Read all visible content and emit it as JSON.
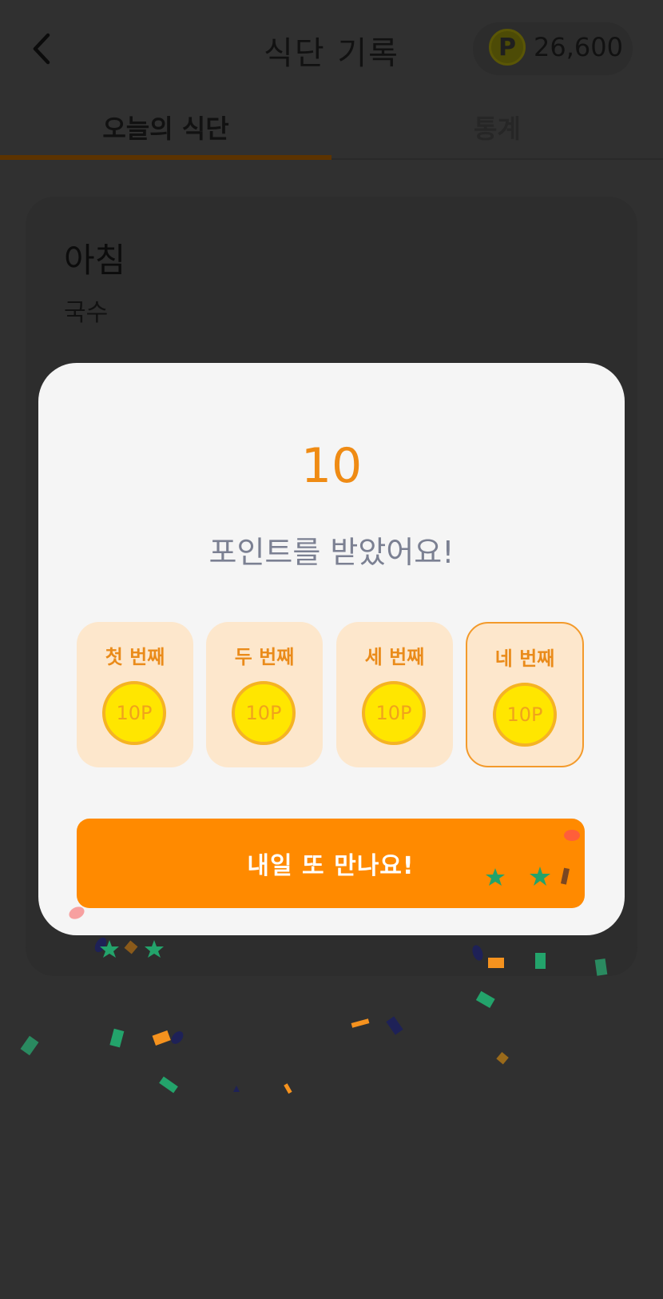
{
  "header": {
    "title": "식단 기록",
    "points": "26,600",
    "coin_symbol": "P"
  },
  "tabs": [
    {
      "label": "오늘의 식단"
    },
    {
      "label": "통계"
    }
  ],
  "meal": {
    "title": "아침",
    "name": "국수"
  },
  "modal": {
    "reward_amount": "10",
    "message": "포인트를 받았어요!",
    "days": [
      {
        "label": "첫 번째",
        "coin": "10P"
      },
      {
        "label": "두 번째",
        "coin": "10P"
      },
      {
        "label": "세 번째",
        "coin": "10P"
      },
      {
        "label": "네 번째",
        "coin": "10P"
      }
    ],
    "cta_label": "내일 또 만나요!"
  },
  "colors": {
    "accent": "#ff8a00",
    "overlay": "#303030",
    "coin": "#ffe600",
    "card": "#fde7cc"
  }
}
